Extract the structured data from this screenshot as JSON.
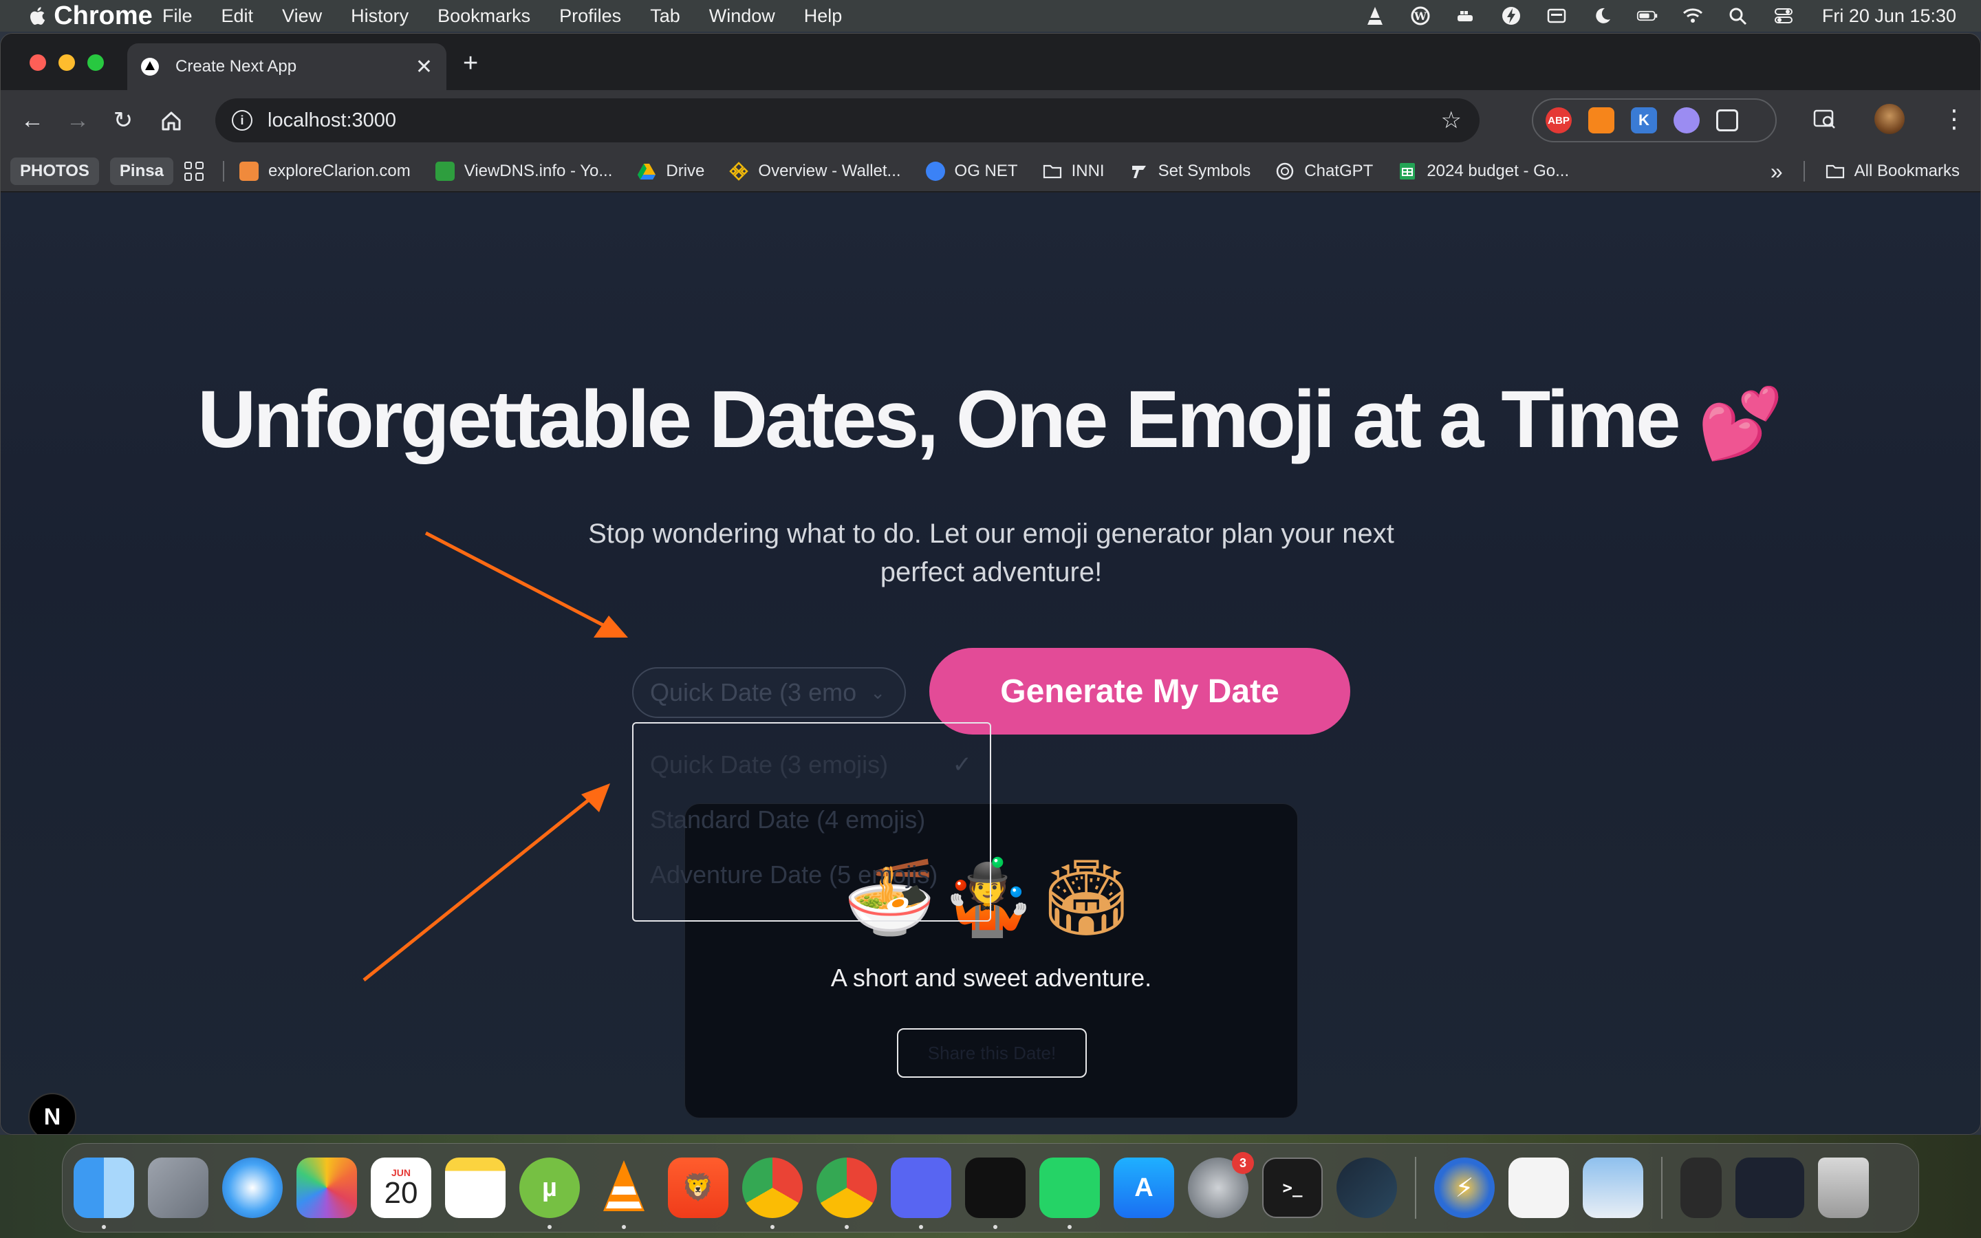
{
  "menubar": {
    "app_name": "Chrome",
    "items": [
      "File",
      "Edit",
      "View",
      "History",
      "Bookmarks",
      "Profiles",
      "Tab",
      "Window",
      "Help"
    ],
    "clock": "Fri 20 Jun  15:30"
  },
  "browser": {
    "tab_title": "Create Next App",
    "tab_close": "✕",
    "new_tab": "+",
    "url": "localhost:3000",
    "extensions": {
      "abp": "ABP",
      "k": "K"
    },
    "bookmarks": {
      "pill1": "PHOTOS",
      "pill2": "Pinsa",
      "items": [
        {
          "label": "exploreClarion.com",
          "color": "#f08a3c"
        },
        {
          "label": "ViewDNS.info - Yo...",
          "color": "#2e9e3e"
        },
        {
          "label": "Drive",
          "color": "#f5b400"
        },
        {
          "label": "Overview - Wallet...",
          "color": "#f0b90b"
        },
        {
          "label": "OG NET",
          "color": "#3b82f6"
        },
        {
          "label": "INNI",
          "color": "folder"
        },
        {
          "label": "Set Symbols",
          "color": "#222222"
        },
        {
          "label": "ChatGPT",
          "color": "#ffffff"
        },
        {
          "label": "2024 budget - Go...",
          "color": "#23a455"
        }
      ],
      "overflow": "»",
      "all_bookmarks": "All Bookmarks"
    }
  },
  "page": {
    "title": "Unforgettable Dates, One Emoji at a Time",
    "title_emoji": "💕",
    "subtitle": "Stop wondering what to do. Let our emoji generator plan your next perfect adventure!",
    "select": {
      "value": "Quick Date (3 emo",
      "chevron": "⌄",
      "options": [
        {
          "label": "Quick Date (3 emojis)",
          "check": "✓"
        },
        {
          "label": "Standard Date (4 emojis)",
          "check": ""
        },
        {
          "label": "Adventure Date (5 emojis)",
          "check": ""
        }
      ]
    },
    "generate_label": "Generate My Date",
    "result": {
      "emojis": "🍜🤹🏟",
      "description": "A short and sweet adventure.",
      "share_label": "Share this Date!"
    },
    "next_badge": "N"
  },
  "dock": {
    "calendar_month": "JUN",
    "calendar_day": "20",
    "settings_badge": "3"
  },
  "colors": {
    "accent": "#e34b97",
    "arrow": "#ff6a13"
  }
}
